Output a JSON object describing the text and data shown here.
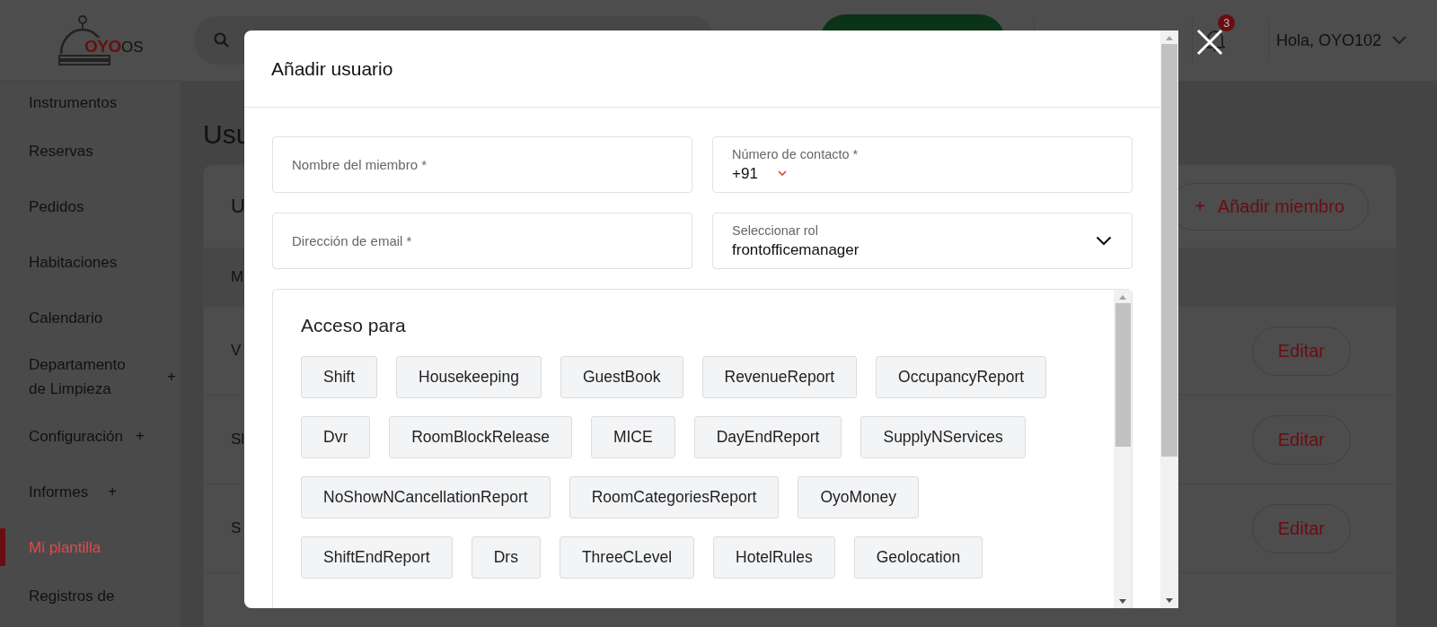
{
  "header": {
    "logo": {
      "brand": "OYO",
      "product": "OS"
    },
    "notifications": {
      "count": "3"
    },
    "greeting": "Hola, OYO102"
  },
  "sidebar": {
    "items": [
      {
        "label": "Instrumentos",
        "selected": false
      },
      {
        "label": "Reservas",
        "selected": false
      },
      {
        "label": "Pedidos",
        "selected": false
      },
      {
        "label": "Habitaciones",
        "selected": false
      },
      {
        "label": "Calendario",
        "selected": false
      },
      {
        "label": "Departamento de Limpieza",
        "expander": "+",
        "selected": false
      },
      {
        "label": "Configuración",
        "expander": "+",
        "selected": false
      },
      {
        "label": "Informes",
        "expander": "+",
        "selected": false
      },
      {
        "label": "Mi plantilla",
        "selected": true
      },
      {
        "label": "Registros de",
        "selected": false
      }
    ]
  },
  "page": {
    "title": "Usu",
    "card": {
      "title": "U",
      "add_button": {
        "icon": "+",
        "label": "Añadir miembro"
      },
      "column_1": "M",
      "rows": [
        {
          "cell": "V",
          "action": "Editar"
        },
        {
          "cell": "Sl",
          "action": "Editar"
        },
        {
          "cell": "S",
          "action": "Editar"
        }
      ]
    }
  },
  "modal": {
    "title": "Añadir usuario",
    "fields": [
      {
        "kind": "text",
        "placeholder": "Nombre del miembro *"
      },
      {
        "kind": "phone",
        "label": "Número de contacto *",
        "value": "+91"
      },
      {
        "kind": "text",
        "placeholder": "Dirección de email *"
      },
      {
        "kind": "select",
        "label": "Seleccionar rol",
        "value": "frontofficemanager"
      }
    ],
    "access": {
      "title": "Acceso para",
      "chips": [
        "Shift",
        "Housekeeping",
        "GuestBook",
        "RevenueReport",
        "OccupancyReport",
        "Dvr",
        "RoomBlockRelease",
        "MICE",
        "DayEndReport",
        "SupplyNServices",
        "NoShowNCancellationReport",
        "RoomCategoriesReport",
        "OyoMoney",
        "ShiftEndReport",
        "Drs",
        "ThreeCLevel",
        "HotelRules",
        "Geolocation"
      ]
    }
  }
}
